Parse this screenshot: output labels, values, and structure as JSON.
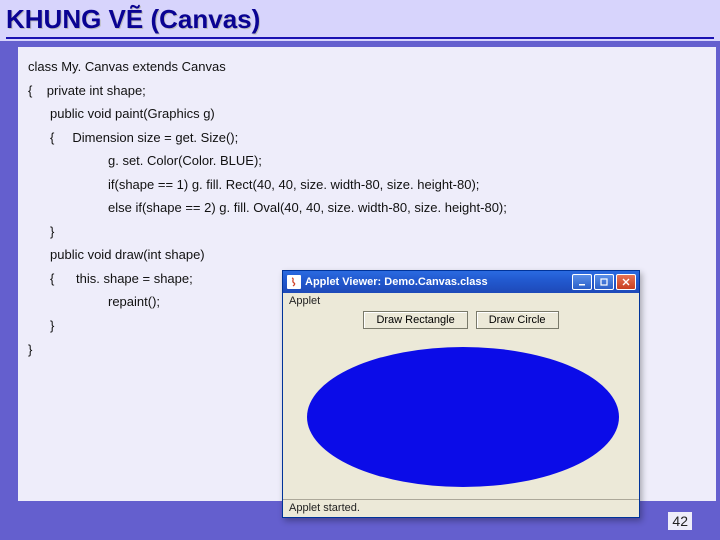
{
  "header": {
    "title": "KHUNG VẼ (Canvas)"
  },
  "code": {
    "l1": "class My. Canvas extends Canvas",
    "l2": "{    private int shape;",
    "l3": "public void paint(Graphics g)",
    "l4": "{     Dimension size = get. Size();",
    "l5": "g. set. Color(Color. BLUE);",
    "l6": "if(shape == 1) g. fill. Rect(40, 40, size. width-80, size. height-80);",
    "l7": "else if(shape == 2) g. fill. Oval(40, 40, size. width-80, size. height-80);",
    "l8": "}",
    "l9": "public void draw(int shape)",
    "l10": "{      this. shape = shape;",
    "l11": "repaint();",
    "l12": "}",
    "l13": "}"
  },
  "applet": {
    "title": "Applet Viewer: Demo.Canvas.class",
    "label": "Applet",
    "buttons": {
      "rect": "Draw Rectangle",
      "circle": "Draw Circle"
    },
    "status": "Applet started."
  },
  "page": "42"
}
